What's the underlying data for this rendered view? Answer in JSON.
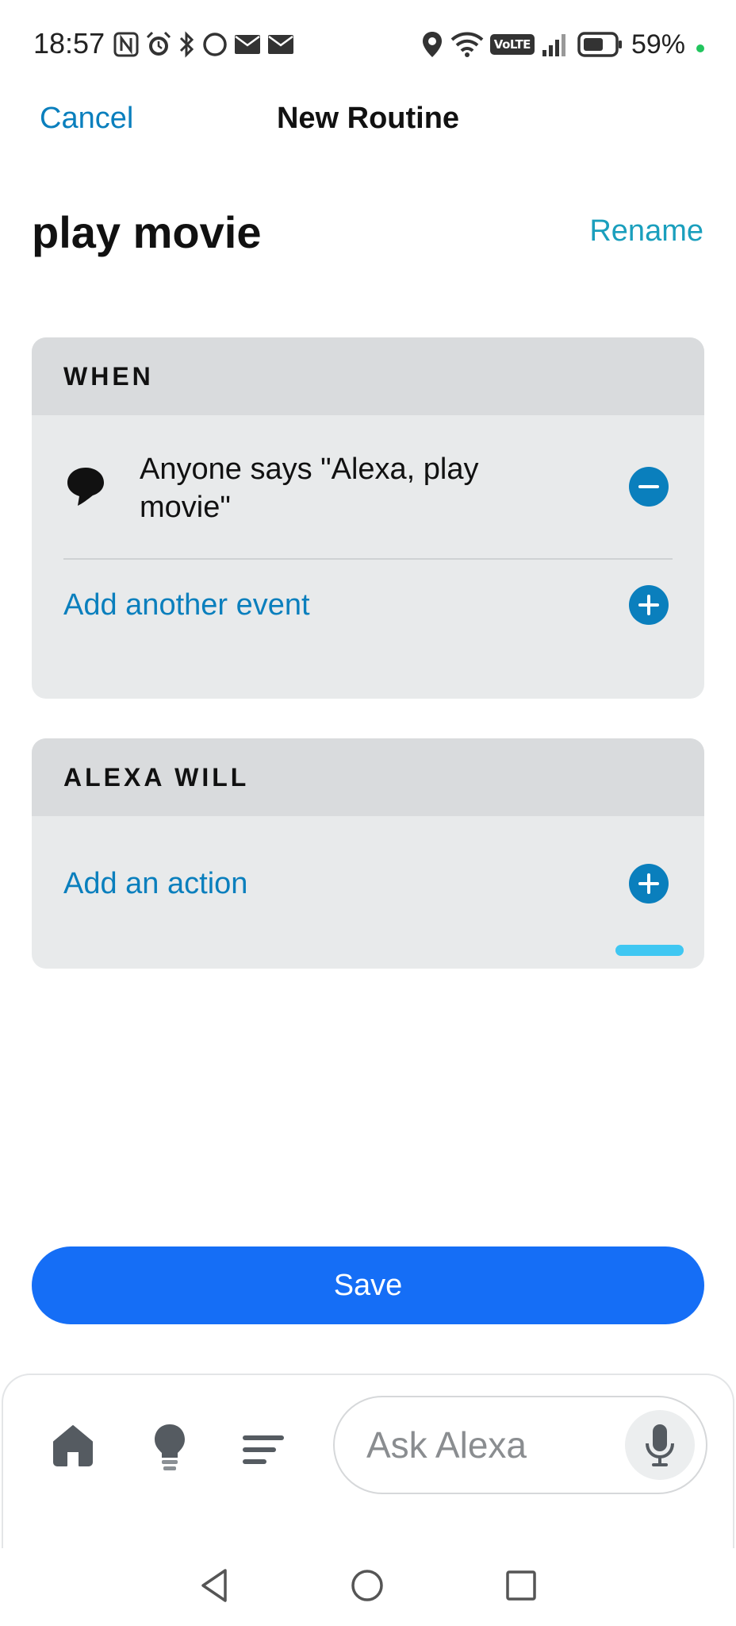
{
  "status_bar": {
    "time": "18:57",
    "volte": "VoLTE",
    "battery": "59%",
    "left_icons": [
      "nfc-icon",
      "alarm-icon",
      "bluetooth-icon",
      "circle-icon",
      "mail-icon",
      "mail-icon"
    ],
    "right_icons": [
      "location-icon",
      "wifi-icon",
      "volte-icon",
      "signal-icon",
      "battery-icon"
    ]
  },
  "header": {
    "cancel_label": "Cancel",
    "title": "New Routine"
  },
  "routine": {
    "name": "play movie",
    "rename_label": "Rename"
  },
  "when_card": {
    "heading": "WHEN",
    "event_text": "Anyone says \"Alexa, play movie\"",
    "add_event_label": "Add another event"
  },
  "will_card": {
    "heading": "ALEXA WILL",
    "add_action_label": "Add an action"
  },
  "save_label": "Save",
  "bottom_bar": {
    "ask_placeholder": "Ask Alexa",
    "nav_icons": [
      "home-icon",
      "lightbulb-icon",
      "menu-icon",
      "microphone-icon"
    ]
  },
  "colors": {
    "link_blue": "#0a7fbd",
    "rename_blue": "#1a9fbd",
    "save_blue": "#156ef6",
    "card_bg": "#e8eaeb",
    "card_header_bg": "#d9dbdd",
    "battery_dot": "#22c55e"
  }
}
